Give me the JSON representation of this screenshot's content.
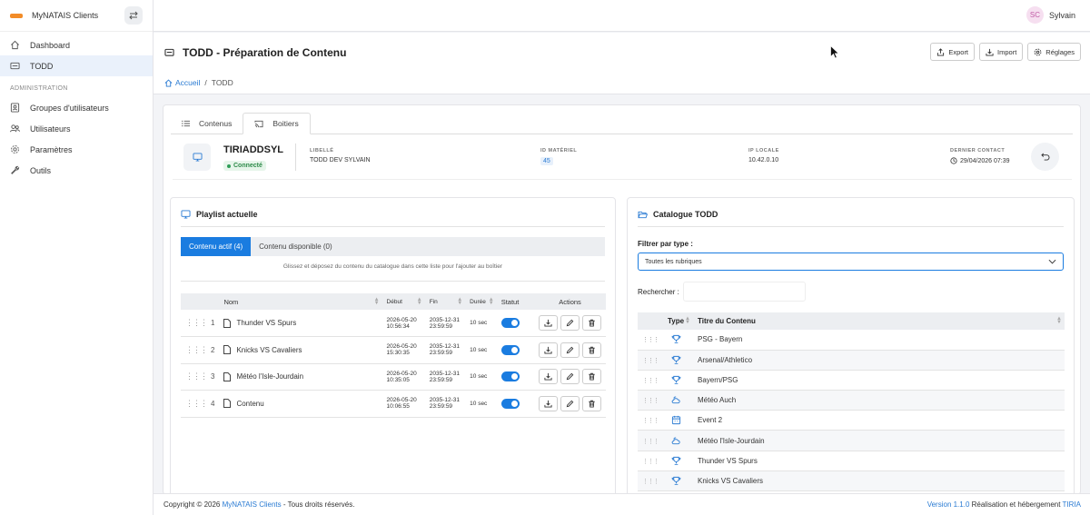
{
  "app": {
    "name": "MyNATAIS Clients"
  },
  "sidebar": {
    "items": [
      {
        "label": "Dashboard",
        "icon": "home-icon"
      },
      {
        "label": "TODD",
        "icon": "monitor-icon"
      }
    ],
    "section_label": "ADMINISTRATION",
    "admin_items": [
      {
        "label": "Groupes d'utilisateurs",
        "icon": "user-group-icon"
      },
      {
        "label": "Utilisateurs",
        "icon": "users-icon"
      },
      {
        "label": "Paramètres",
        "icon": "gear-icon"
      },
      {
        "label": "Outils",
        "icon": "wrench-icon"
      }
    ]
  },
  "user": {
    "initials": "SC",
    "name": "Sylvain"
  },
  "page": {
    "title": "TODD - Préparation de Contenu",
    "buttons": {
      "export": "Export",
      "import": "Import",
      "settings": "Réglages"
    },
    "breadcrumb": {
      "home": "Accueil",
      "current": "TODD"
    }
  },
  "tabs": [
    {
      "label": "Contenus"
    },
    {
      "label": "Boitiers"
    }
  ],
  "device": {
    "name": "TIRIADDSYL",
    "status": "Connecté",
    "libelle_label": "LIBELLÉ",
    "libelle": "TODD DEV SYLVAIN",
    "id_label": "ID MATÉRIEL",
    "id": "45",
    "ip_label": "IP LOCALE",
    "ip": "10.42.0.10",
    "contact_label": "DERNIER CONTACT",
    "contact": "29/04/2026 07:39"
  },
  "playlist": {
    "title": "Playlist actuelle",
    "tab_active": "Contenu actif (4)",
    "tab_available": "Contenu disponible (0)",
    "hint": "Glissez et déposez du contenu du catalogue dans cette liste pour l'ajouter au boîtier",
    "columns": {
      "name": "Nom",
      "start": "Début",
      "end": "Fin",
      "duration": "Durée",
      "status": "Statut",
      "actions": "Actions"
    },
    "rows": [
      {
        "n": "1",
        "name": "Thunder VS Spurs",
        "start_d": "2026-05-20",
        "start_t": "10:56:34",
        "end_d": "2035-12-31",
        "end_t": "23:59:59",
        "dur": "10 sec"
      },
      {
        "n": "2",
        "name": "Knicks VS Cavaliers",
        "start_d": "2026-05-20",
        "start_t": "15:30:35",
        "end_d": "2035-12-31",
        "end_t": "23:59:59",
        "dur": "10 sec"
      },
      {
        "n": "3",
        "name": "Météo l'Isle-Jourdain",
        "start_d": "2026-05-20",
        "start_t": "10:35:05",
        "end_d": "2035-12-31",
        "end_t": "23:59:59",
        "dur": "10 sec"
      },
      {
        "n": "4",
        "name": "Contenu",
        "start_d": "2026-05-20",
        "start_t": "10:06:55",
        "end_d": "2035-12-31",
        "end_t": "23:59:59",
        "dur": "10 sec"
      }
    ]
  },
  "catalogue": {
    "title": "Catalogue TODD",
    "filter_label": "Filtrer par type :",
    "filter_value": "Toutes les rubriques",
    "search_label": "Rechercher :",
    "columns": {
      "type": "Type",
      "title": "Titre du Contenu"
    },
    "rows": [
      {
        "title": "PSG - Bayern",
        "icon": "trophy-icon"
      },
      {
        "title": "Arsenal/Athletico",
        "icon": "trophy-icon"
      },
      {
        "title": "Bayern/PSG",
        "icon": "trophy-icon"
      },
      {
        "title": "Météo Auch",
        "icon": "cloud-sun-icon"
      },
      {
        "title": "Event 2",
        "icon": "calendar-icon"
      },
      {
        "title": "Météo l'Isle-Jourdain",
        "icon": "cloud-sun-icon"
      },
      {
        "title": "Thunder VS Spurs",
        "icon": "trophy-icon"
      },
      {
        "title": "Knicks VS Cavaliers",
        "icon": "trophy-icon"
      }
    ]
  },
  "footer": {
    "copyright": "Copyright © 2026 ",
    "brand": "MyNATAIS Clients",
    "rights": " - Tous droits réservés.",
    "version": "Version 1.1.0",
    "credit": " Réalisation et hébergement ",
    "company": "TIRIA"
  },
  "colors": {
    "accent": "#1a7ce0",
    "success": "#2e8b4a",
    "logo": "#f28c28"
  }
}
